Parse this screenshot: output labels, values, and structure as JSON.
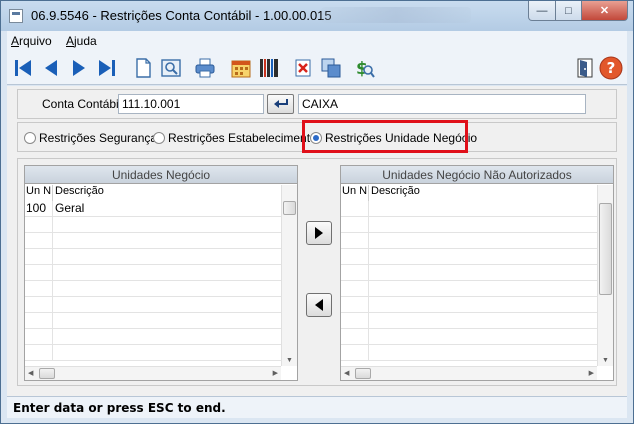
{
  "window": {
    "title": "06.9.5546 - Restrições Conta Contábil - 1.00.00.015",
    "controls": {
      "minimize": "—",
      "maximize": "□",
      "close": "✕"
    }
  },
  "menu": [
    {
      "underline": "A",
      "rest": "rquivo"
    },
    {
      "underline": "A",
      "rest": "juda"
    }
  ],
  "toolbar": {
    "icons": [
      "first-record-icon",
      "previous-record-icon",
      "next-record-icon",
      "last-record-icon",
      "new-document-icon",
      "preview-icon",
      "print-icon",
      "calendar-icon",
      "barcode-icon",
      "delete-icon",
      "copy-icon",
      "money-search-icon",
      "exit-door-icon",
      "help-icon"
    ]
  },
  "form": {
    "conta_label": "Conta Contábil:",
    "conta_value": "111.10.001",
    "conta_desc": "CAIXA"
  },
  "radios": {
    "seguranca": "Restrições Segurança",
    "estabelecimento": "Restrições Estabelecimento",
    "unidade": "Restrições Unidade Negócio",
    "selected": "unidade"
  },
  "left_grid": {
    "title": "Unidades Negócio",
    "col_un": "Un N",
    "col_desc": "Descrição",
    "rows": [
      {
        "un": "100",
        "desc": "Geral"
      },
      {
        "un": "",
        "desc": ""
      },
      {
        "un": "",
        "desc": ""
      },
      {
        "un": "",
        "desc": ""
      },
      {
        "un": "",
        "desc": ""
      },
      {
        "un": "",
        "desc": ""
      },
      {
        "un": "",
        "desc": ""
      },
      {
        "un": "",
        "desc": ""
      },
      {
        "un": "",
        "desc": ""
      },
      {
        "un": "",
        "desc": ""
      }
    ]
  },
  "right_grid": {
    "title": "Unidades Negócio Não Autorizados",
    "col_un": "Un N",
    "col_desc": "Descrição",
    "rows": [
      {
        "un": "",
        "desc": ""
      },
      {
        "un": "",
        "desc": ""
      },
      {
        "un": "",
        "desc": ""
      },
      {
        "un": "",
        "desc": ""
      },
      {
        "un": "",
        "desc": ""
      },
      {
        "un": "",
        "desc": ""
      },
      {
        "un": "",
        "desc": ""
      },
      {
        "un": "",
        "desc": ""
      },
      {
        "un": "",
        "desc": ""
      },
      {
        "un": "",
        "desc": ""
      }
    ]
  },
  "status": "Enter data or press ESC to end.",
  "colors": {
    "accent": "#2c6ac8",
    "highlight": "#e0101a",
    "help": "#e2572b"
  }
}
